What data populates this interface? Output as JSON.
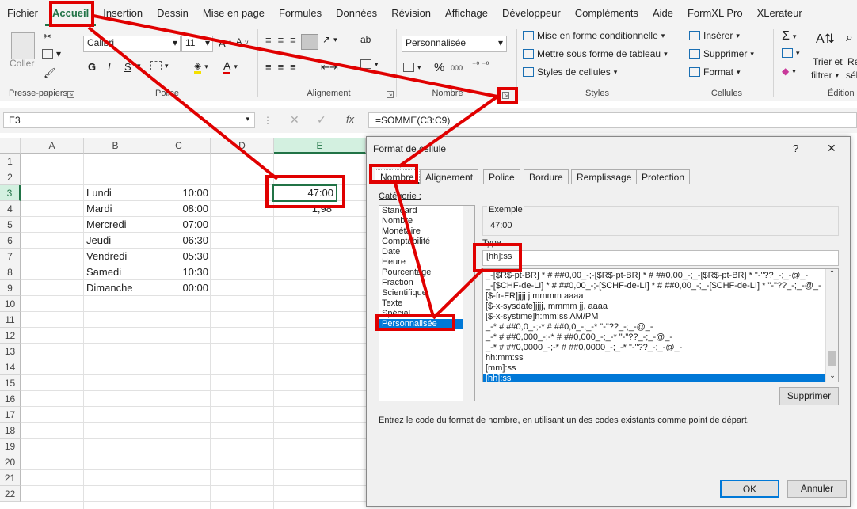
{
  "ribbon_tabs": [
    "Fichier",
    "Accueil",
    "Insertion",
    "Dessin",
    "Mise en page",
    "Formules",
    "Données",
    "Révision",
    "Affichage",
    "Développeur",
    "Compléments",
    "Aide",
    "FormXL Pro",
    "XLerateur"
  ],
  "ribbon": {
    "clipboard": {
      "paste": "Coller",
      "label": "Presse-papiers"
    },
    "font": {
      "name": "Calibri",
      "size": "11",
      "label": "Police",
      "bold": "G",
      "italic": "I",
      "underline": "S"
    },
    "alignment": {
      "label": "Alignement",
      "wrap": "ab"
    },
    "number": {
      "format": "Personnalisée",
      "label": "Nombre",
      "percent": "%",
      "thousands": "000"
    },
    "styles": {
      "cond": "Mise en forme conditionnelle",
      "table": "Mettre sous forme de tableau",
      "cell": "Styles de cellules",
      "label": "Styles"
    },
    "cells": {
      "insert": "Insérer",
      "delete": "Supprimer",
      "format": "Format",
      "label": "Cellules"
    },
    "editing": {
      "sort1": "Trier et",
      "sort2": "filtrer",
      "label": "Édition",
      "cut1": "Re",
      "cut2": "sél"
    }
  },
  "formula_bar": {
    "name_box": "E3",
    "fx": "fx",
    "formula": "=SOMME(C3:C9)"
  },
  "sheet": {
    "columns": [
      "A",
      "B",
      "C",
      "D",
      "E"
    ],
    "rows": [
      "1",
      "2",
      "3",
      "4",
      "5",
      "6",
      "7",
      "8",
      "9",
      "10",
      "11",
      "12",
      "13",
      "14",
      "15",
      "16",
      "17",
      "18",
      "19",
      "20",
      "21",
      "22"
    ],
    "days": [
      "Lundi",
      "Mardi",
      "Mercredi",
      "Jeudi",
      "Vendredi",
      "Samedi",
      "Dimanche"
    ],
    "times": [
      "10:00",
      "08:00",
      "07:00",
      "06:30",
      "05:30",
      "10:30",
      "00:00"
    ],
    "e3": "47:00",
    "e4": "1,98"
  },
  "dialog": {
    "title": "Format de cellule",
    "help": "?",
    "close": "✕",
    "tabs": [
      "Nombre",
      "Alignement",
      "Police",
      "Bordure",
      "Remplissage",
      "Protection"
    ],
    "category_label": "Catégorie :",
    "categories": [
      "Standard",
      "Nombre",
      "Monétaire",
      "Comptabilité",
      "Date",
      "Heure",
      "Pourcentage",
      "Fraction",
      "Scientifique",
      "Texte",
      "Spécial",
      "Personnalisée"
    ],
    "sample_label": "Exemple",
    "sample_value": "47:00",
    "type_label": "Type :",
    "type_value": "[hh]:ss",
    "formats": [
      "_-[$R$-pt-BR] * # ##0,00_-;-[$R$-pt-BR] * # ##0,00_-;_-[$R$-pt-BR] * \"-\"??_-;_-@_-",
      "_-[$CHF-de-LI] * # ##0,00_-;-[$CHF-de-LI] * # ##0,00_-;_-[$CHF-de-LI] * \"-\"??_-;_-@_-",
      "[$-fr-FR]jjjj j mmmm aaaa",
      "[$-x-sysdate]jjjj, mmmm jj, aaaa",
      "[$-x-systime]h:mm:ss AM/PM",
      "_-* # ##0,0_-;-* # ##0,0_-;_-* \"-\"??_-;_-@_-",
      "_-* # ##0,000_-;-* # ##0,000_-;_-* \"-\"??_-;_-@_-",
      "_-* # ##0,0000_-;-* # ##0,0000_-;_-* \"-\"??_-;_-@_-",
      "hh:mm:ss",
      "[mm]:ss",
      "[hh]:ss"
    ],
    "delete_btn": "Supprimer",
    "hint": "Entrez le code du format de nombre, en utilisant un des codes existants comme point de départ.",
    "ok": "OK",
    "cancel": "Annuler"
  },
  "colors": {
    "accent": "#217346",
    "annotation": "#e00000",
    "selection": "#0078d7"
  }
}
